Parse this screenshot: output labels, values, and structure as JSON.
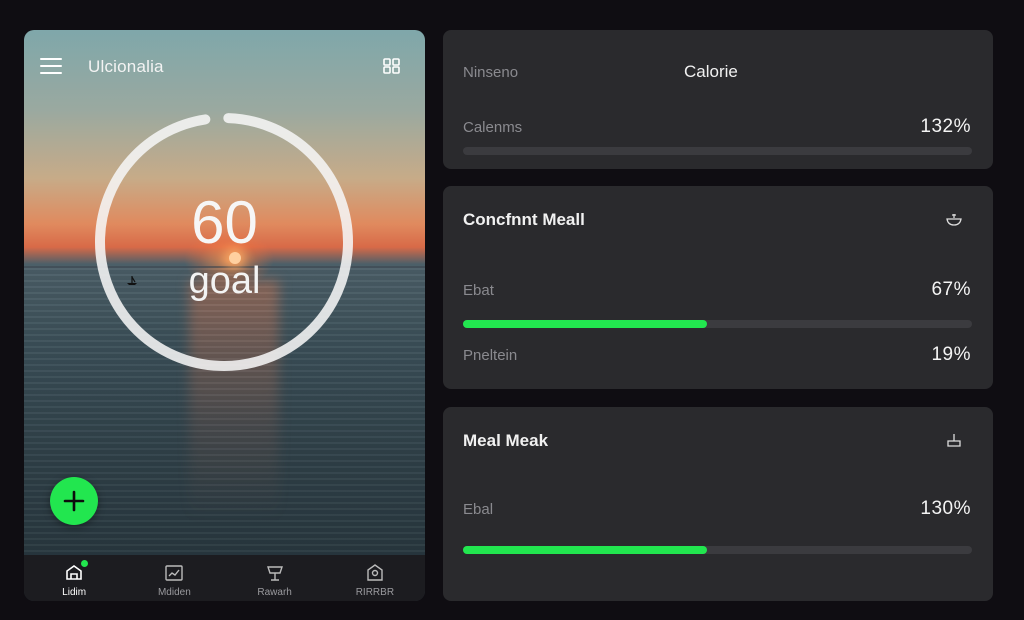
{
  "app": {
    "title": "Ulcionalia",
    "header_action_icon": "grid-icon",
    "menu_icon": "hamburger-menu-icon"
  },
  "goal_ring": {
    "value": "60",
    "label": "goal",
    "progress": 0.97
  },
  "fab": {
    "icon": "plus-icon",
    "color": "#22e64f"
  },
  "bottom_nav": [
    {
      "label": "Lidim",
      "icon": "home-icon",
      "active": true
    },
    {
      "label": "Mdiden",
      "icon": "stats-icon",
      "active": false
    },
    {
      "label": "Rawarh",
      "icon": "food-icon",
      "active": false
    },
    {
      "label": "RIRRBR",
      "icon": "profile-icon",
      "active": false
    }
  ],
  "cards": {
    "summary": {
      "left_label": "Ninseno",
      "title": "Calorie",
      "row_label": "Calenms",
      "row_value": "132%",
      "progress": 0
    },
    "meal_one": {
      "title": "Concfnnt Meall",
      "icon": "bowl-icon",
      "row1_label": "Ebat",
      "row1_value": "67%",
      "row1_progress": 0.48,
      "row2_label": "Pneltein",
      "row2_value": "19%"
    },
    "meal_two": {
      "title": "Meal Meak",
      "icon": "cup-icon",
      "row_label": "Ebal",
      "row_value": "130%",
      "row_progress": 0.48
    }
  },
  "colors": {
    "accent": "#22e64f",
    "card_bg": "#2a2a2d",
    "page_bg": "#0f0d12"
  }
}
